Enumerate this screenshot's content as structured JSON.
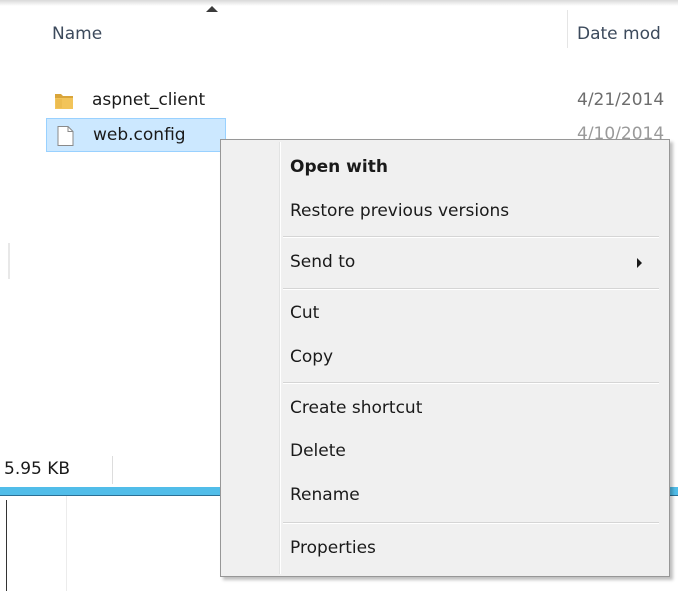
{
  "columns": {
    "name_label": "Name",
    "date_label": "Date mod"
  },
  "files": [
    {
      "name": "aspnet_client",
      "date": "4/21/2014",
      "icon": "folder-icon",
      "selected": false
    },
    {
      "name": "web.config",
      "date": "4/10/2014",
      "icon": "file-icon",
      "selected": true
    }
  ],
  "status": {
    "size": "5.95 KB"
  },
  "context_menu": {
    "items": [
      {
        "label": "Open with",
        "bold": true
      },
      {
        "label": "Restore previous versions"
      },
      {
        "label": "Send to",
        "submenu": true
      },
      {
        "label": "Cut"
      },
      {
        "label": "Copy"
      },
      {
        "label": "Create shortcut"
      },
      {
        "label": "Delete"
      },
      {
        "label": "Rename"
      },
      {
        "label": "Properties"
      }
    ]
  },
  "colors": {
    "selection": "#cce8ff",
    "selection_border": "#99d1ff",
    "progress": "#51bde9",
    "menu_bg": "#f0f0f0",
    "folder": "#e8b84a"
  }
}
